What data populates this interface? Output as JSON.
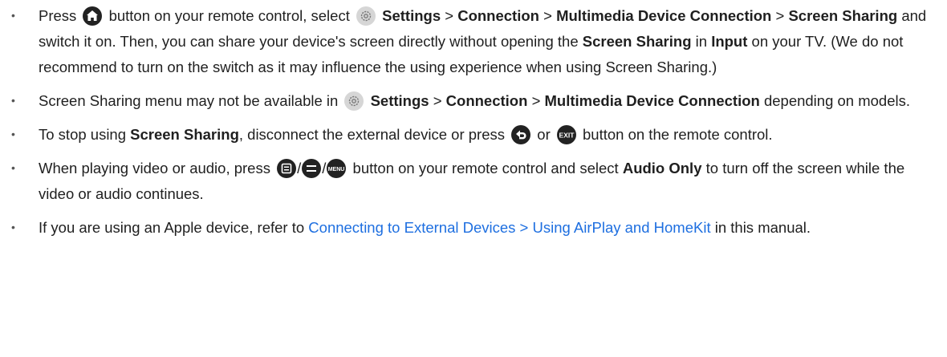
{
  "items": [
    {
      "bullet": "•",
      "t1": "Press",
      "t2": "button on your remote control, select",
      "t3": "Settings",
      "sep1": ">",
      "t4": "Connection",
      "sep2": ">",
      "t5": "Multimedia Device Connection",
      "sep3": ">",
      "t6": "Screen Sharing",
      "t7": "and switch it on. Then, you can share your device's screen directly without opening the",
      "t8": "Screen Sharing",
      "t9": "in",
      "t10": "Input",
      "t11": "on your TV. (We do not recommend to turn on the switch as it may influence the using experience when using Screen Sharing.)"
    },
    {
      "bullet": "•",
      "t1": "Screen Sharing menu may not be available in",
      "t2": "Settings",
      "sep1": ">",
      "t3": "Connection",
      "sep2": ">",
      "t4": "Multimedia Device Connection",
      "t5": "depending on models."
    },
    {
      "bullet": "•",
      "t1": "To stop using",
      "t2": "Screen Sharing",
      "t3": ", disconnect the external device or press",
      "t4": "or",
      "t5": "button on the remote control."
    },
    {
      "bullet": "•",
      "t1": "When playing video or audio, press",
      "slash1": "/",
      "slash2": "/",
      "t2": "button on your remote control and select",
      "t3": "Audio Only",
      "t4": "to turn off the screen while the video or audio continues."
    },
    {
      "bullet": "•",
      "t1": "If you are using an Apple device, refer to",
      "link": "Connecting to External Devices > Using AirPlay and HomeKit",
      "t2": "in this manual."
    }
  ],
  "icons": {
    "home": "home-icon",
    "settings": "settings-gear-icon",
    "back": "back-icon",
    "exit": "exit-icon",
    "menu_square": "menu-square-icon",
    "menu_round": "menu-round-icon",
    "menu_text": "menu-text-icon",
    "exit_label": "EXIT",
    "menu_label": "MENU"
  },
  "colors": {
    "text": "#1f1f1f",
    "link": "#1e6fe0",
    "icon_dark": "#222222",
    "icon_light": "#d6d6d6"
  }
}
